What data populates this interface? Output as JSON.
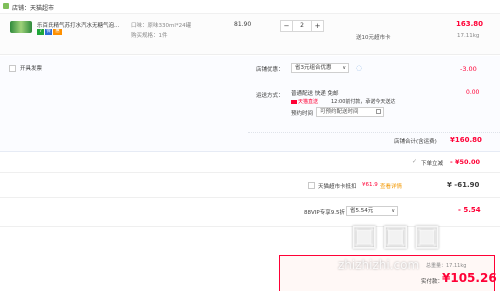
{
  "shop": {
    "icon": "shop-icon",
    "label": "店铺：天猫超市"
  },
  "item": {
    "title": "乐百氏精气苏打水汽水无糖气泡...",
    "sku_line1": "口味：原味330ml*24罐",
    "sku_line2": "购买规格：1件",
    "unit_price": "81.90",
    "quantity": "2",
    "promo_note": "送10元超市卡",
    "subtotal": "163.80",
    "weight": "17.11kg",
    "badge_colors": {
      "green": "#1fa63a",
      "blue": "#2f6fd6",
      "orange": "#ff9000"
    }
  },
  "options": {
    "invoice_label": "开具发票",
    "shop_discount_label": "店铺优惠：",
    "shop_discount_value": "省3元组合优惠",
    "shop_discount_amount": "-3.00",
    "delivery_label": "运送方式：",
    "delivery_text": "普通配送 快递 免邮",
    "delivery_badge": "天猫直送",
    "delivery_time": "12:00前付款，承诺今天送达",
    "delivery_fee": "0.00",
    "schedule_label": "预约时间",
    "schedule_value": "可预约配送时间"
  },
  "store_total": {
    "label": "店铺合计(含运费)",
    "value": "¥160.80"
  },
  "coupon": {
    "label": "下单立减",
    "value": "- ¥50.00"
  },
  "card": {
    "label": "天猫超市卡抵扣",
    "value_note": "¥61.9",
    "view_link": "查看详情",
    "amount": "¥ -61.90"
  },
  "vip": {
    "label": "88VIP专享9.5折",
    "select_value": "省5.54元",
    "amount": "- 5.54"
  },
  "summary": {
    "weight": "总重量：17.11kg",
    "payable_label": "实付款：",
    "payable_value": "105.26"
  },
  "watermark": {
    "site": "zhizhizhi.com"
  },
  "colors": {
    "accent_red": "#ff0036",
    "opt_bg": "#fbfcff"
  }
}
